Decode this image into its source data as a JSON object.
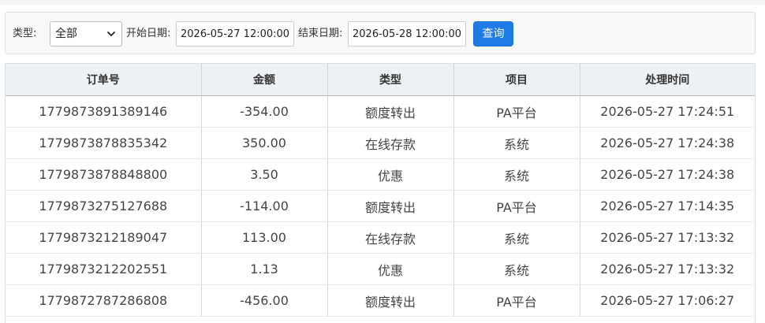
{
  "filters": {
    "type_label": "类型:",
    "type_value": "全部",
    "start_label": "开始日期:",
    "start_value": "2026-05-27 12:00:00",
    "end_label": "结束日期:",
    "end_value": "2026-05-28 12:00:00",
    "query_label": "查询"
  },
  "colors": {
    "accent": "#1e7ce8",
    "header_bg": "#eef1f4",
    "column_divider": "#f0c9cc"
  },
  "table": {
    "columns": [
      "订单号",
      "金额",
      "类型",
      "项目",
      "处理时间"
    ],
    "rows": [
      [
        "1779873891389146",
        "-354.00",
        "额度转出",
        "PA平台",
        "2026-05-27 17:24:51"
      ],
      [
        "1779873878835342",
        "350.00",
        "在线存款",
        "系统",
        "2026-05-27 17:24:38"
      ],
      [
        "1779873878848800",
        "3.50",
        "优惠",
        "系统",
        "2026-05-27 17:24:38"
      ],
      [
        "1779873275127688",
        "-114.00",
        "额度转出",
        "PA平台",
        "2026-05-27 17:14:35"
      ],
      [
        "1779873212189047",
        "113.00",
        "在线存款",
        "系统",
        "2026-05-27 17:13:32"
      ],
      [
        "1779873212202551",
        "1.13",
        "优惠",
        "系统",
        "2026-05-27 17:13:32"
      ],
      [
        "1779872787286808",
        "-456.00",
        "额度转出",
        "PA平台",
        "2026-05-27 17:06:27"
      ]
    ]
  }
}
